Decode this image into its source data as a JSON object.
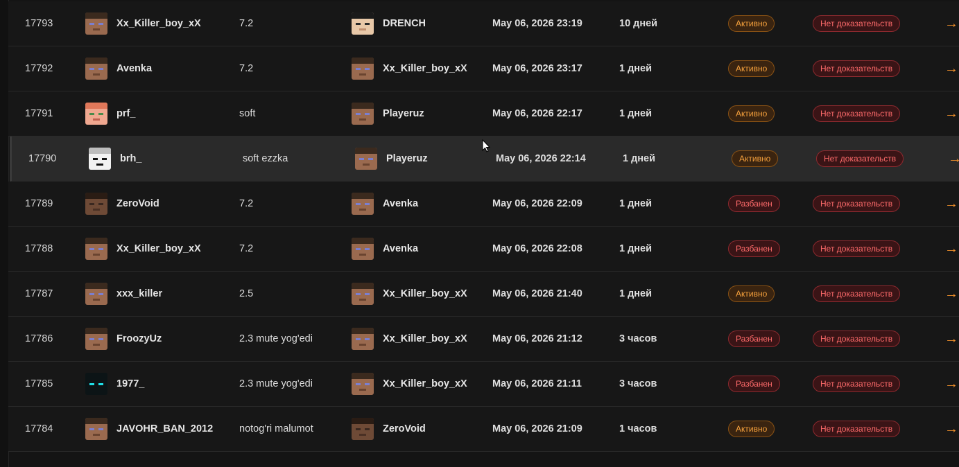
{
  "colors": {
    "accent": "#f0902a",
    "active": "#f7a23d",
    "banned": "#ff6b6b"
  },
  "rows": [
    {
      "id": "17793",
      "player": "Xx_Killer_boy_xX",
      "player_skin": "steve",
      "reason": "7.2",
      "admin": "DRENCH",
      "admin_skin": "drench",
      "date": "May 06, 2026 23:19",
      "duration": "10 дней",
      "status": "Активно",
      "status_type": "active",
      "proof": "Нет доказательств",
      "arrow": "→"
    },
    {
      "id": "17792",
      "player": "Avenka",
      "player_skin": "steve",
      "reason": "7.2",
      "admin": "Xx_Killer_boy_xX",
      "admin_skin": "steve",
      "date": "May 06, 2026 23:17",
      "duration": "1 дней",
      "status": "Активно",
      "status_type": "active",
      "proof": "Нет доказательств",
      "arrow": "→"
    },
    {
      "id": "17791",
      "player": "prf_",
      "player_skin": "alex",
      "reason": "soft",
      "admin": "Playeruz",
      "admin_skin": "steve",
      "date": "May 06, 2026 22:17",
      "duration": "1 дней",
      "status": "Активно",
      "status_type": "active",
      "proof": "Нет доказательств",
      "arrow": "→"
    },
    {
      "id": "17790",
      "player": "brh_",
      "player_skin": "ghost",
      "reason": "soft ezzka",
      "admin": "Playeruz",
      "admin_skin": "steve",
      "date": "May 06, 2026 22:14",
      "duration": "1 дней",
      "status": "Активно",
      "status_type": "active",
      "proof": "Нет доказательств",
      "arrow": "→",
      "hovered": true
    },
    {
      "id": "17789",
      "player": "ZeroVoid",
      "player_skin": "dark",
      "reason": "7.2",
      "admin": "Avenka",
      "admin_skin": "steve",
      "date": "May 06, 2026 22:09",
      "duration": "1 дней",
      "status": "Разбанен",
      "status_type": "banned",
      "proof": "Нет доказательств",
      "arrow": "→"
    },
    {
      "id": "17788",
      "player": "Xx_Killer_boy_xX",
      "player_skin": "steve",
      "reason": "7.2",
      "admin": "Avenka",
      "admin_skin": "steve",
      "date": "May 06, 2026 22:08",
      "duration": "1 дней",
      "status": "Разбанен",
      "status_type": "banned",
      "proof": "Нет доказательств",
      "arrow": "→"
    },
    {
      "id": "17787",
      "player": "xxx_killer",
      "player_skin": "steve",
      "reason": "2.5",
      "admin": "Xx_Killer_boy_xX",
      "admin_skin": "steve",
      "date": "May 06, 2026 21:40",
      "duration": "1 дней",
      "status": "Активно",
      "status_type": "active",
      "proof": "Нет доказательств",
      "arrow": "→"
    },
    {
      "id": "17786",
      "player": "FroozyUz",
      "player_skin": "steve",
      "reason": "2.3 mute yog'edi",
      "admin": "Xx_Killer_boy_xX",
      "admin_skin": "steve",
      "date": "May 06, 2026 21:12",
      "duration": "3 часов",
      "status": "Разбанен",
      "status_type": "banned",
      "proof": "Нет доказательств",
      "arrow": "→"
    },
    {
      "id": "17785",
      "player": "1977_",
      "player_skin": "black",
      "reason": "2.3 mute yog'edi",
      "admin": "Xx_Killer_boy_xX",
      "admin_skin": "steve",
      "date": "May 06, 2026 21:11",
      "duration": "3 часов",
      "status": "Разбанен",
      "status_type": "banned",
      "proof": "Нет доказательств",
      "arrow": "→"
    },
    {
      "id": "17784",
      "player": "JAVOHR_BAN_2012",
      "player_skin": "steve",
      "reason": "notog'ri malumot",
      "admin": "ZeroVoid",
      "admin_skin": "dark",
      "date": "May 06, 2026 21:09",
      "duration": "1 часов",
      "status": "Активно",
      "status_type": "active",
      "proof": "Нет доказательств",
      "arrow": "→"
    }
  ]
}
